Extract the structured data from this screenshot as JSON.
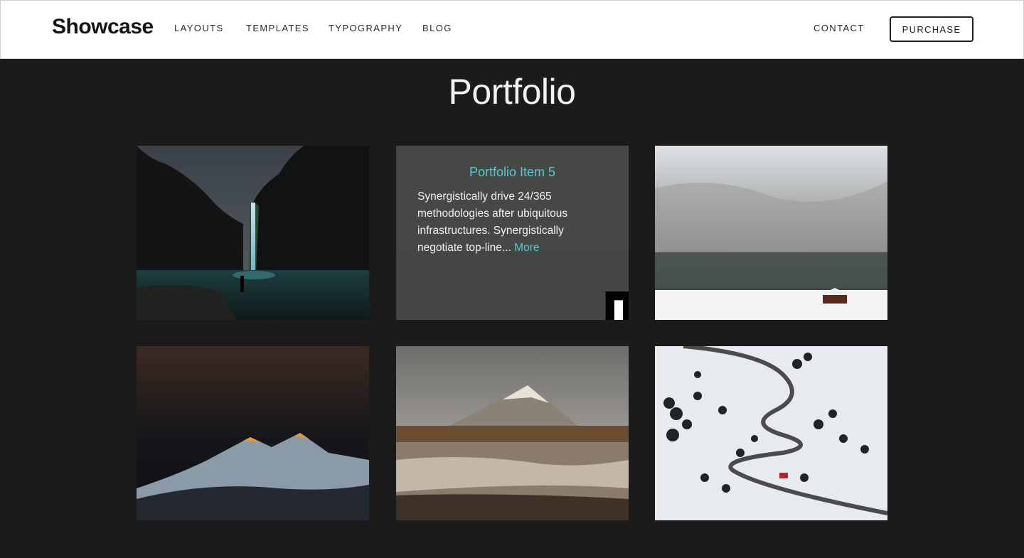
{
  "header": {
    "logo": "Showcase",
    "nav": [
      "LAYOUTS",
      "TEMPLATES",
      "TYPOGRAPHY",
      "BLOG"
    ],
    "contact": "CONTACT",
    "purchase": "PURCHASE"
  },
  "main": {
    "title": "Portfolio",
    "hover_item": {
      "title": "Portfolio Item 5",
      "description": "Synergistically drive 24/365 methodologies after ubiquitous infrastructures. Synergistically negotiate top-line...",
      "more": "More"
    }
  },
  "colors": {
    "accent": "#5ec4cf",
    "page_background": "#1b1b1b",
    "header_background": "#ffffff"
  }
}
